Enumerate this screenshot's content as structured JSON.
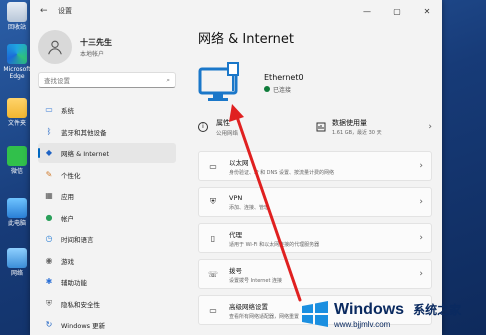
{
  "desktop_icons": [
    {
      "icon": "recycle-bin-icon",
      "label": "回收站"
    },
    {
      "icon": "edge-icon",
      "label": "Microsoft Edge"
    },
    {
      "icon": "folder-icon",
      "label": "文件夹"
    },
    {
      "icon": "wechat-icon",
      "label": "微信"
    },
    {
      "icon": "this-pc-icon",
      "label": "此电脑"
    },
    {
      "icon": "network-icon",
      "label": "网络"
    }
  ],
  "window": {
    "title": "设置"
  },
  "profile": {
    "name": "十三先生",
    "account": "本地帐户"
  },
  "search": {
    "placeholder": "查找设置"
  },
  "sidebar": {
    "items": [
      {
        "label": "系统",
        "icon": "system-icon"
      },
      {
        "label": "蓝牙和其他设备",
        "icon": "bluetooth-icon"
      },
      {
        "label": "网络 & Internet",
        "icon": "wifi-icon"
      },
      {
        "label": "个性化",
        "icon": "brush-icon"
      },
      {
        "label": "应用",
        "icon": "apps-icon"
      },
      {
        "label": "帐户",
        "icon": "account-icon"
      },
      {
        "label": "时间和语言",
        "icon": "clock-icon"
      },
      {
        "label": "游戏",
        "icon": "game-icon"
      },
      {
        "label": "辅助功能",
        "icon": "accessibility-icon"
      },
      {
        "label": "隐私和安全性",
        "icon": "shield-icon"
      },
      {
        "label": "Windows 更新",
        "icon": "update-icon"
      }
    ]
  },
  "main": {
    "title": "网络 & Internet",
    "adapter": {
      "name": "Ethernet0",
      "status": "已连接"
    },
    "properties": {
      "title": "属性",
      "sub": "公用网络"
    },
    "data_usage": {
      "title": "数据使用量",
      "sub": "1.61 GB，最近 30 天"
    },
    "cards": [
      {
        "icon": "ethernet-icon",
        "title": "以太网",
        "sub": "身份验证、IP 和 DNS 设置、按流量计费的网络"
      },
      {
        "icon": "vpn-shield-icon",
        "title": "VPN",
        "sub": "添加、连接、管理"
      },
      {
        "icon": "proxy-icon",
        "title": "代理",
        "sub": "适用于 Wi-Fi 和以太网连接的代理服务器"
      },
      {
        "icon": "dialup-icon",
        "title": "拨号",
        "sub": "设置拨号 Internet 连接"
      },
      {
        "icon": "advanced-network-icon",
        "title": "高级网络设置",
        "sub": "查看所有网络适配器，网络重置"
      }
    ]
  },
  "watermark": {
    "title": "Windows",
    "cn": "系统之家",
    "url": "www.bjjmlv.com"
  },
  "colors": {
    "accent": "#0067c0",
    "arrow": "#e02020",
    "monitor": "#1a77c9"
  }
}
